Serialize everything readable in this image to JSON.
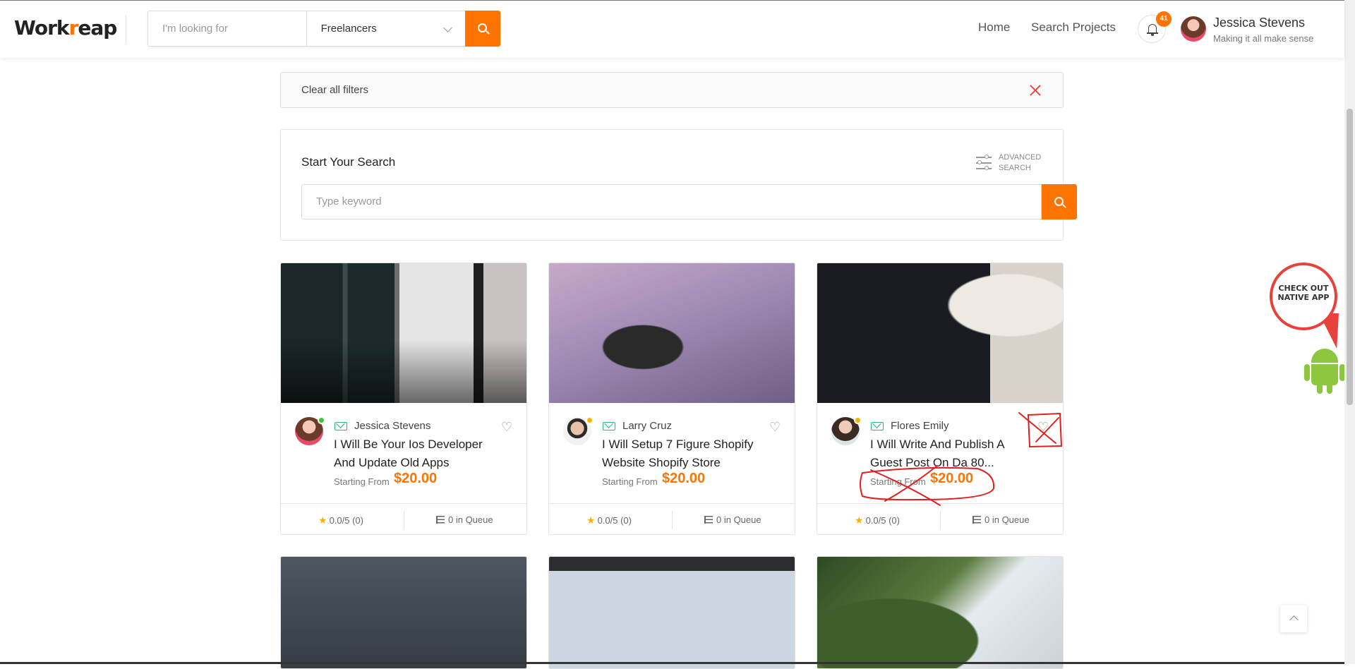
{
  "header": {
    "logo_text": "Workreap",
    "search_placeholder": "I'm looking for",
    "search_category": "Freelancers",
    "nav": [
      "Home",
      "Search Projects"
    ],
    "notification_count": "41",
    "user": {
      "name": "Jessica Stevens",
      "tagline": "Making it all make sense"
    }
  },
  "filters": {
    "clear_label": "Clear all filters"
  },
  "search_panel": {
    "title": "Start Your Search",
    "advanced_label": "ADVANCED SEARCH",
    "keyword_placeholder": "Type keyword"
  },
  "cards": [
    {
      "seller": "Jessica Stevens",
      "title_line1": "I Will Be Your Ios Developer",
      "title_line2": "And Update Old Apps",
      "from_label": "Starting From",
      "price": "$20.00",
      "rating": "0.0/5 (0)",
      "queue": "0 in Queue",
      "status_color": "#3cc43c"
    },
    {
      "seller": "Larry Cruz",
      "title_line1": "I Will Setup 7 Figure Shopify",
      "title_line2": "Website Shopify Store",
      "from_label": "Starting From",
      "price": "$20.00",
      "rating": "0.0/5 (0)",
      "queue": "0 in Queue",
      "status_color": "#f5b400"
    },
    {
      "seller": "Flores Emily",
      "title_line1": "I Will Write And Publish A",
      "title_line2": "Guest Post On Da 80...",
      "from_label": "Starting From",
      "price": "$20.00",
      "rating": "0.0/5 (0)",
      "queue": "0 in Queue",
      "status_color": "#f5b400"
    }
  ],
  "promo": {
    "text": "CHECK OUT NATIVE APP"
  },
  "colors": {
    "accent": "#ff7300",
    "annotation": "#e02020"
  }
}
